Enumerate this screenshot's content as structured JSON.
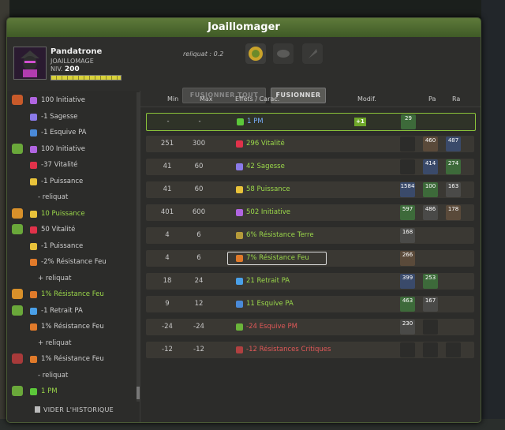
{
  "window": {
    "title": "Joaillomager"
  },
  "character": {
    "name": "Pandatrone",
    "job": "JOAILLOMAGE",
    "level_label": "NIV.",
    "level": "200",
    "xp_fraction": 1.0
  },
  "reliquat": "reliquat : 0.2",
  "buttons": {
    "fuse_all": "FUSIONNER TOUT",
    "fuse": "FUSIONNER"
  },
  "history": {
    "clear_label": "VIDER L'HISTORIQUE",
    "rows": [
      {
        "text": "100 Initiative",
        "style": "normal",
        "icon": "initiative-icon",
        "has_item": true
      },
      {
        "text": "-1 Sagesse",
        "style": "normal",
        "icon": "wisdom-icon",
        "has_item": false
      },
      {
        "text": "-1 Esquive PA",
        "style": "normal",
        "icon": "ap-dodge-icon",
        "has_item": false
      },
      {
        "text": "100 Initiative",
        "style": "normal",
        "icon": "initiative-icon",
        "has_item": true
      },
      {
        "text": "-37 Vitalité",
        "style": "normal",
        "icon": "vitality-icon",
        "has_item": false
      },
      {
        "text": "-1 Puissance",
        "style": "normal",
        "icon": "power-icon",
        "has_item": false
      },
      {
        "text": "- reliquat",
        "style": "sub",
        "icon": "",
        "has_item": false
      },
      {
        "text": "10 Puissance",
        "style": "green",
        "icon": "power-icon",
        "has_item": true
      },
      {
        "text": "50 Vitalité",
        "style": "normal",
        "icon": "vitality-icon",
        "has_item": true
      },
      {
        "text": "-1 Puissance",
        "style": "normal",
        "icon": "power-icon",
        "has_item": false
      },
      {
        "text": "-2% Résistance Feu",
        "style": "normal",
        "icon": "fire-resist-icon",
        "has_item": false
      },
      {
        "text": "+ reliquat",
        "style": "sub",
        "icon": "",
        "has_item": false
      },
      {
        "text": "1% Résistance Feu",
        "style": "green",
        "icon": "fire-resist-icon",
        "has_item": true
      },
      {
        "text": "-1 Retrait PA",
        "style": "normal",
        "icon": "ap-reduction-icon",
        "has_item": true
      },
      {
        "text": "1% Résistance Feu",
        "style": "normal",
        "icon": "fire-resist-icon",
        "has_item": false
      },
      {
        "text": "+ reliquat",
        "style": "sub",
        "icon": "",
        "has_item": false
      },
      {
        "text": "1% Résistance Feu",
        "style": "normal",
        "icon": "fire-resist-icon",
        "has_item": true
      },
      {
        "text": "- reliquat",
        "style": "sub",
        "icon": "",
        "has_item": false
      },
      {
        "text": "1 PM",
        "style": "green",
        "icon": "mp-icon",
        "has_item": true
      }
    ]
  },
  "table": {
    "headers": {
      "min": "Min",
      "max": "Max",
      "effects": "Effets / Carac.",
      "modif": "Modif.",
      "pa": "Pa",
      "ra": "Ra"
    },
    "rows": [
      {
        "min": "-",
        "max": "-",
        "effect": "1 PM",
        "tone": "blue",
        "icon": "mp-icon",
        "modif": "+1",
        "runes": [
          "29"
        ],
        "selected": true
      },
      {
        "min": "251",
        "max": "300",
        "effect": "296 Vitalité",
        "tone": "pos",
        "icon": "vitality-icon",
        "modif": "",
        "runes": [
          "",
          "460",
          "487"
        ]
      },
      {
        "min": "41",
        "max": "60",
        "effect": "42 Sagesse",
        "tone": "pos",
        "icon": "wisdom-icon",
        "modif": "",
        "runes": [
          "",
          "414",
          "274"
        ]
      },
      {
        "min": "41",
        "max": "60",
        "effect": "58 Puissance",
        "tone": "pos",
        "icon": "power-icon",
        "modif": "",
        "runes": [
          "1584",
          "100",
          "163"
        ]
      },
      {
        "min": "401",
        "max": "600",
        "effect": "502 Initiative",
        "tone": "pos",
        "icon": "initiative-icon",
        "modif": "",
        "runes": [
          "597",
          "486",
          "178"
        ]
      },
      {
        "min": "4",
        "max": "6",
        "effect": "6% Résistance Terre",
        "tone": "pos",
        "icon": "earth-resist-icon",
        "modif": "",
        "runes": [
          "168"
        ]
      },
      {
        "min": "4",
        "max": "6",
        "effect": "7% Résistance Feu",
        "tone": "pos",
        "icon": "fire-resist-icon",
        "modif": "",
        "runes": [
          "266"
        ],
        "focused": true
      },
      {
        "min": "18",
        "max": "24",
        "effect": "21 Retrait PA",
        "tone": "pos",
        "icon": "ap-reduction-icon",
        "modif": "",
        "runes": [
          "399",
          "253"
        ]
      },
      {
        "min": "9",
        "max": "12",
        "effect": "11 Esquive PA",
        "tone": "pos",
        "icon": "ap-dodge-icon",
        "modif": "",
        "runes": [
          "463",
          "167"
        ]
      },
      {
        "min": "-24",
        "max": "-24",
        "effect": "-24 Esquive PM",
        "tone": "neg",
        "icon": "mp-dodge-icon",
        "modif": "",
        "runes": [
          "230",
          ""
        ]
      },
      {
        "min": "-12",
        "max": "-12",
        "effect": "-12 Résistances Critiques",
        "tone": "neg",
        "icon": "crit-resist-icon",
        "modif": "",
        "runes": [
          "",
          "",
          ""
        ]
      }
    ]
  },
  "colors": {
    "title_bar": "#4f6d30",
    "positive": "#9bd84a",
    "negative": "#e05858",
    "accent_green": "#8ac23a"
  }
}
